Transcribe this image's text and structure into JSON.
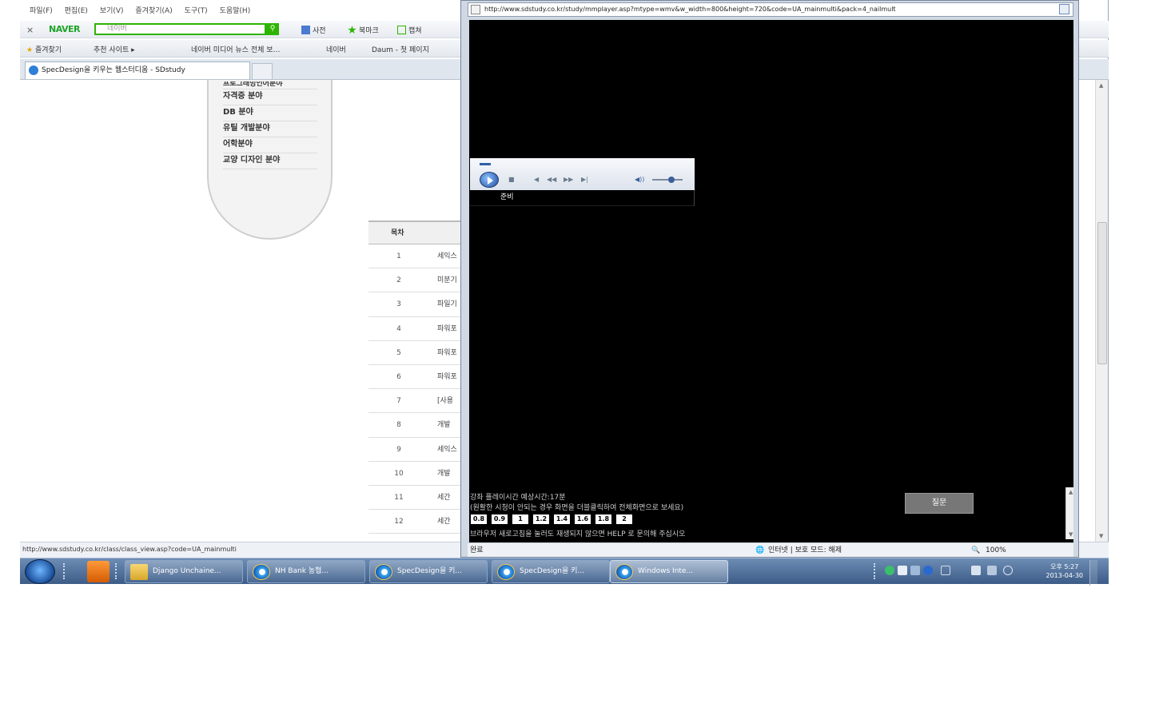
{
  "browser": {
    "menu": [
      "파일(F)",
      "편집(E)",
      "보기(V)",
      "즐겨찾기(A)",
      "도구(T)",
      "도움말(H)"
    ],
    "naver_toolbar": {
      "close": "×",
      "logo": "NAVER",
      "search_placeholder": "네이버",
      "items": [
        "사전",
        "북마크",
        "캡쳐"
      ]
    },
    "favorites": [
      "즐겨찾기",
      "추천 사이트 ▸",
      "네이버 미디어 뉴스 전체 보…",
      "네이버",
      "Daum - 첫 페이지"
    ],
    "active_tab": "SpecDesign을 키우는 웹스터디움 - SDstudy",
    "side_menu": [
      "프로그래밍언어분야",
      "자격증 분야",
      "DB 분야",
      "유틸 개발분야",
      "어학분야",
      "교양 디자인 분야"
    ],
    "table": {
      "header": "목차",
      "rows": [
        {
          "no": "1",
          "title": "세익스"
        },
        {
          "no": "2",
          "title": "미분기"
        },
        {
          "no": "3",
          "title": "파일기"
        },
        {
          "no": "4",
          "title": "파워포"
        },
        {
          "no": "5",
          "title": "파워포"
        },
        {
          "no": "6",
          "title": "파워포"
        },
        {
          "no": "7",
          "title": "[사용"
        },
        {
          "no": "8",
          "title": "개발"
        },
        {
          "no": "9",
          "title": "세익스"
        },
        {
          "no": "10",
          "title": "개발"
        },
        {
          "no": "11",
          "title": "세간"
        },
        {
          "no": "12",
          "title": "세간"
        }
      ]
    },
    "status_url": "http://www.sdstudy.co.kr/class/class_view.asp?code=UA_mainmulti"
  },
  "popup": {
    "address": "http://www.sdstudy.co.kr/study/mmplayer.asp?mtype=wmv&w_width=800&height=720&code=UA_mainmulti&pack=4_nailmult",
    "player": {
      "status": "준비",
      "controls": [
        "■",
        "◀",
        "◀◀",
        "▶▶",
        "▶|",
        "◀))"
      ]
    },
    "info_lines": [
      "강좌 플레이시간 예상시간:17분",
      "(원활한 시청이 안되는 경우 화면을 더블클릭하여 전체화면으로 보세요)",
      "브라우저 새로고침을 눌러도 재생되지 않으면 HELP 로 문의해 주십시오"
    ],
    "speed_buttons": [
      "0.8",
      "0.9",
      "1",
      "1.2",
      "1.4",
      "1.6",
      "1.8",
      "2"
    ],
    "question_button": "질문",
    "status": {
      "left": "완료",
      "zone": "인터넷 | 보호 모드: 해제",
      "zoom": "100%"
    }
  },
  "taskbar": {
    "tasks": [
      {
        "label": "Django Unchaine...",
        "icon": "folder-icon"
      },
      {
        "label": "NH Bank 농협...",
        "icon": "ie-icon"
      },
      {
        "label": "SpecDesign을 키...",
        "icon": "ie-icon"
      },
      {
        "label": "SpecDesign을 키...",
        "icon": "ie-icon"
      },
      {
        "label": "Windows Inte...",
        "icon": "ie-icon"
      }
    ],
    "clock": {
      "time": "오후 5:27",
      "date": "2013-04-30"
    }
  }
}
